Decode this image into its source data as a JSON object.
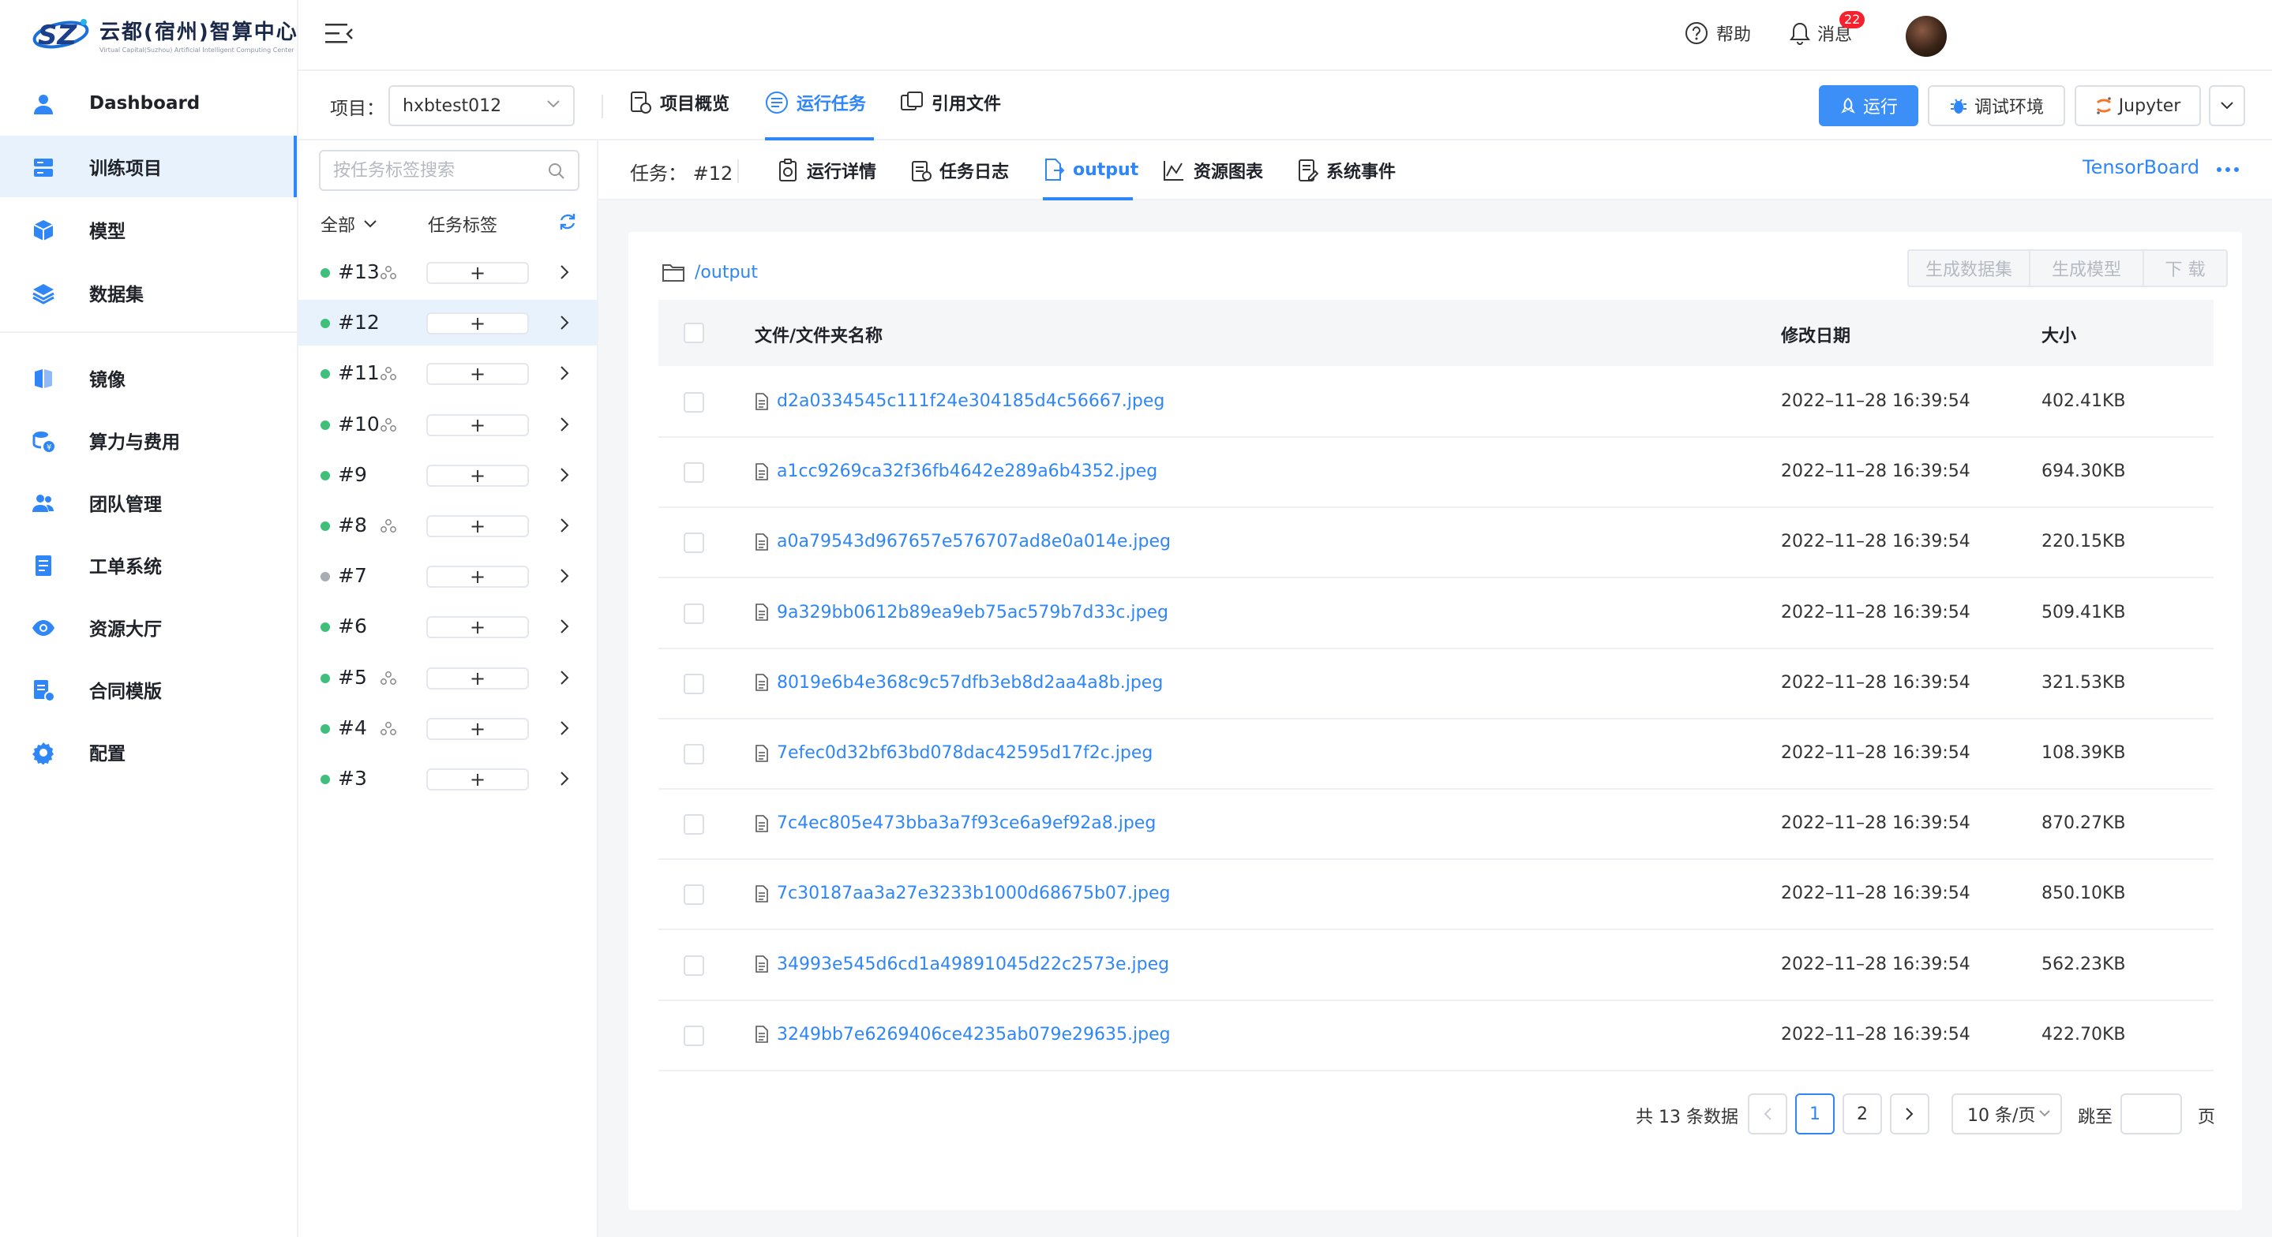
{
  "brand": {
    "name_cn": "云都(宿州)智算中心",
    "name_en": "Virtual Capital(Suzhou) Artificial Intelligent Computing Center"
  },
  "sidebar": {
    "items": [
      {
        "label": "Dashboard",
        "icon": "user-icon"
      },
      {
        "label": "训练项目",
        "icon": "training-project-icon",
        "active": true
      },
      {
        "label": "模型",
        "icon": "cube-icon"
      },
      {
        "label": "数据集",
        "icon": "layers-icon"
      },
      {
        "label": "镜像",
        "icon": "mirror-icon"
      },
      {
        "label": "算力与费用",
        "icon": "compute-cost-icon"
      },
      {
        "label": "团队管理",
        "icon": "team-icon"
      },
      {
        "label": "工单系统",
        "icon": "ticket-icon"
      },
      {
        "label": "资源大厅",
        "icon": "eye-icon"
      },
      {
        "label": "合同模版",
        "icon": "contract-icon"
      },
      {
        "label": "配置",
        "icon": "gear-icon"
      }
    ]
  },
  "header": {
    "help_label": "帮助",
    "notify_label": "消息",
    "notify_count": "22"
  },
  "projectbar": {
    "project_label": "项目：",
    "project_value": "hxbtest012",
    "tabs": [
      {
        "label": "项目概览"
      },
      {
        "label": "运行任务",
        "active": true
      },
      {
        "label": "引用文件"
      }
    ],
    "run_label": "运行",
    "debug_label": "调试环境",
    "jupyter_label": "Jupyter"
  },
  "tasklist": {
    "search_placeholder": "按任务标签搜索",
    "filter_all": "全部",
    "filter_tag": "任务标签",
    "add_symbol": "+",
    "tasks": [
      {
        "id": "#13",
        "status": "running",
        "shared": true
      },
      {
        "id": "#12",
        "status": "running",
        "shared": false,
        "active": true
      },
      {
        "id": "#11",
        "status": "running",
        "shared": true
      },
      {
        "id": "#10",
        "status": "running",
        "shared": true
      },
      {
        "id": "#9",
        "status": "running",
        "shared": false
      },
      {
        "id": "#8",
        "status": "running",
        "shared": true
      },
      {
        "id": "#7",
        "status": "stopped",
        "shared": false
      },
      {
        "id": "#6",
        "status": "running",
        "shared": false
      },
      {
        "id": "#5",
        "status": "running",
        "shared": true
      },
      {
        "id": "#4",
        "status": "running",
        "shared": true
      },
      {
        "id": "#3",
        "status": "running",
        "shared": false
      }
    ]
  },
  "task": {
    "label": "任务：  #12",
    "tabs": [
      {
        "label": "运行详情"
      },
      {
        "label": "任务日志"
      },
      {
        "label": "output",
        "active": true
      },
      {
        "label": "资源图表"
      },
      {
        "label": "系统事件"
      }
    ],
    "tensorboard_label": "TensorBoard"
  },
  "files": {
    "path": "/output",
    "actions": [
      "生成数据集",
      "生成模型",
      "下 载"
    ],
    "columns": [
      "文件/文件夹名称",
      "修改日期",
      "大小"
    ],
    "rows": [
      {
        "name": "d2a0334545c111f24e304185d4c56667.jpeg",
        "date": "2022–11–28 16:39:54",
        "size": "402.41KB"
      },
      {
        "name": "a1cc9269ca32f36fb4642e289a6b4352.jpeg",
        "date": "2022–11–28 16:39:54",
        "size": "694.30KB"
      },
      {
        "name": "a0a79543d967657e576707ad8e0a014e.jpeg",
        "date": "2022–11–28 16:39:54",
        "size": "220.15KB"
      },
      {
        "name": "9a329bb0612b89ea9eb75ac579b7d33c.jpeg",
        "date": "2022–11–28 16:39:54",
        "size": "509.41KB"
      },
      {
        "name": "8019e6b4e368c9c57dfb3eb8d2aa4a8b.jpeg",
        "date": "2022–11–28 16:39:54",
        "size": "321.53KB"
      },
      {
        "name": "7efec0d32bf63bd078dac42595d17f2c.jpeg",
        "date": "2022–11–28 16:39:54",
        "size": "108.39KB"
      },
      {
        "name": "7c4ec805e473bba3a7f93ce6a9ef92a8.jpeg",
        "date": "2022–11–28 16:39:54",
        "size": "870.27KB"
      },
      {
        "name": "7c30187aa3a27e3233b1000d68675b07.jpeg",
        "date": "2022–11–28 16:39:54",
        "size": "850.10KB"
      },
      {
        "name": "34993e545d6cd1a49891045d22c2573e.jpeg",
        "date": "2022–11–28 16:39:54",
        "size": "562.23KB"
      },
      {
        "name": "3249bb7e6269406ce4235ab079e29635.jpeg",
        "date": "2022–11–28 16:39:54",
        "size": "422.70KB"
      }
    ]
  },
  "pagination": {
    "total_label": "共 13 条数据",
    "pages": [
      "1",
      "2"
    ],
    "current_page": "1",
    "page_size": "10 条/页",
    "jump_label": "跳至",
    "page_suffix": "页"
  },
  "colors": {
    "accent": "#2f86f6",
    "primary_button": "#3b8ff7",
    "status_running": "#3fc07a",
    "status_stopped": "#a8acb3",
    "badge": "#f5222d"
  }
}
